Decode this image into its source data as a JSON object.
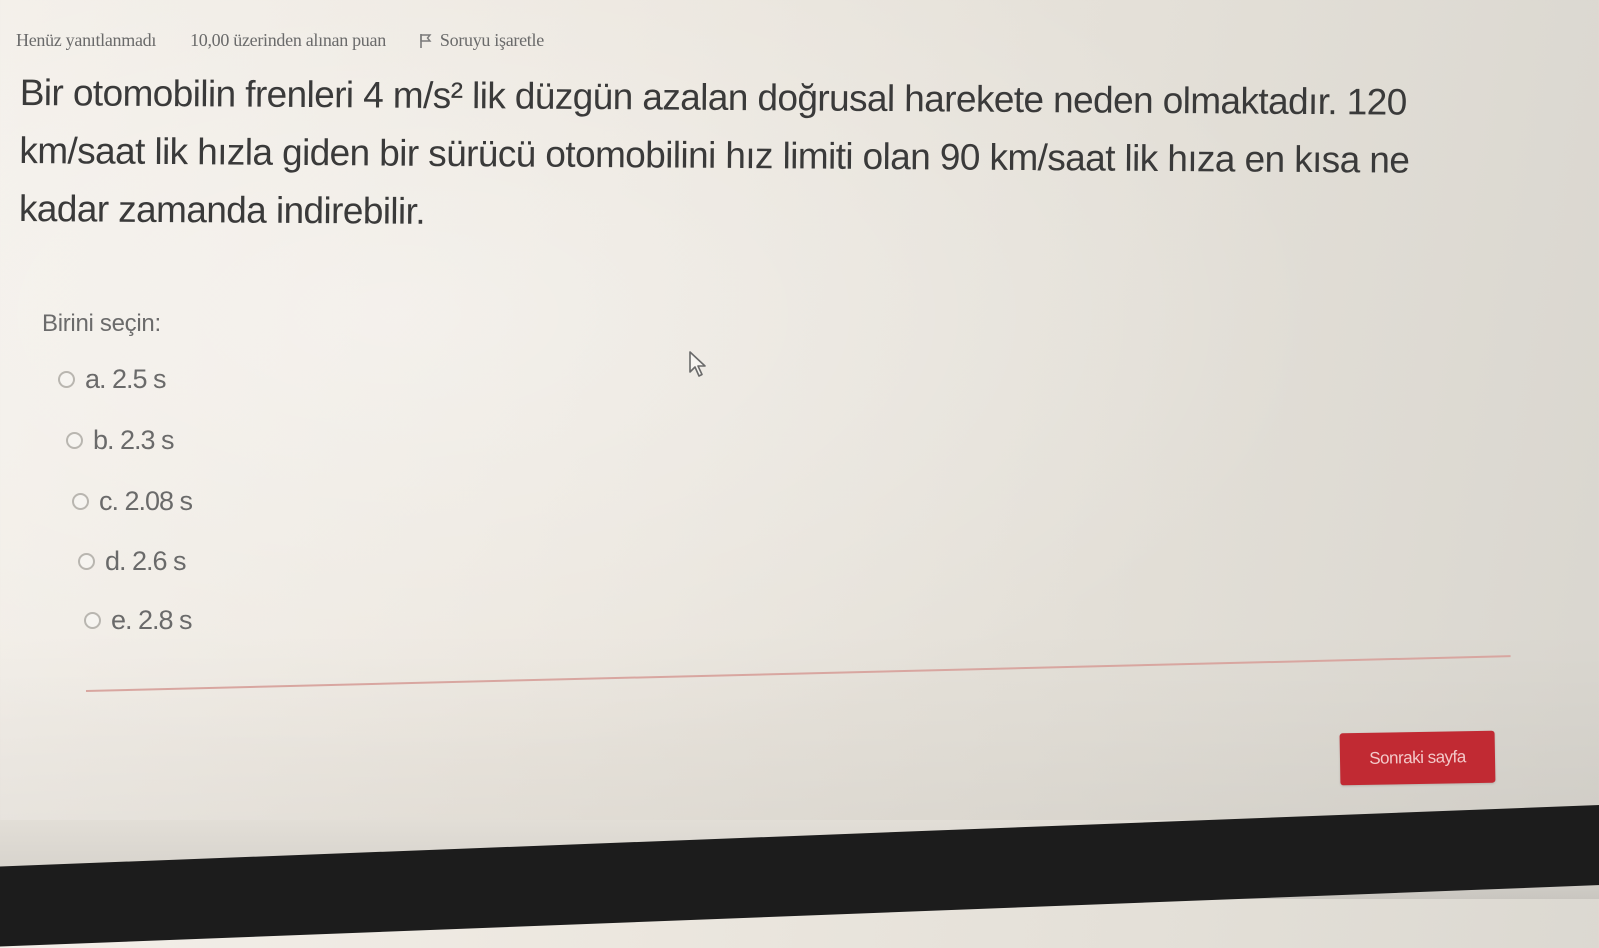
{
  "question_info": {
    "state": "Henüz yanıtlanmadı",
    "grade": "10,00 üzerinden alınan puan",
    "flag_label": "Soruyu işaretle",
    "flag_icon": "flag-icon"
  },
  "question": {
    "line1": "Bir otomobilin frenleri 4 m/s² lik düzgün azalan doğrusal harekete neden olmaktadır. 120",
    "line2": "km/saat lik hızla giden bir sürücü otomobilini hız limiti olan 90 km/saat lik hıza en kısa ne",
    "line3": "kadar zamanda indirebilir."
  },
  "answers": {
    "prompt": "Birini seçin:",
    "options": [
      {
        "label": "a. 2.5 s",
        "selected": false
      },
      {
        "label": "b. 2.3 s",
        "selected": false
      },
      {
        "label": "c. 2.08 s",
        "selected": false
      },
      {
        "label": "d. 2.6 s",
        "selected": false
      },
      {
        "label": "e. 2.8 s",
        "selected": false
      }
    ]
  },
  "navigation": {
    "next_label": "Sonraki sayfa"
  },
  "colors": {
    "accent": "#c12a33",
    "divider": "#d8a6a0"
  }
}
